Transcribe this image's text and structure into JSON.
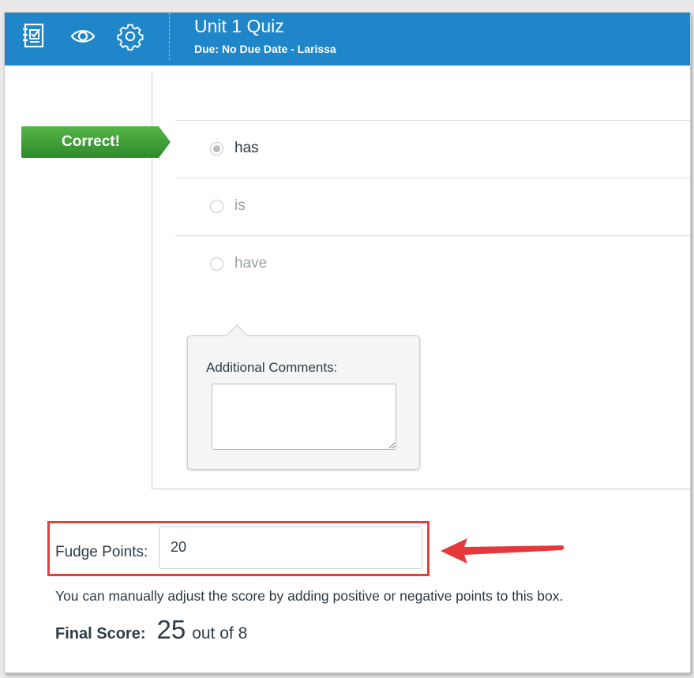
{
  "header": {
    "title": "Unit 1 Quiz",
    "subtitle": "Due: No Due Date - Larissa",
    "icons": [
      "gradebook-icon",
      "eye-icon",
      "gear-icon"
    ],
    "color": "#1f86c9"
  },
  "question": {
    "result_label": "Correct!",
    "answers": [
      {
        "label": "has",
        "selected": true
      },
      {
        "label": "is",
        "selected": false
      },
      {
        "label": "have",
        "selected": false
      }
    ]
  },
  "comments": {
    "label": "Additional Comments:",
    "value": ""
  },
  "fudge": {
    "label": "Fudge Points:",
    "value": "20",
    "hint": "You can manually adjust the score by adding positive or negative points to this box."
  },
  "score": {
    "label": "Final Score:",
    "value": "25",
    "out_of": "out of 8"
  }
}
